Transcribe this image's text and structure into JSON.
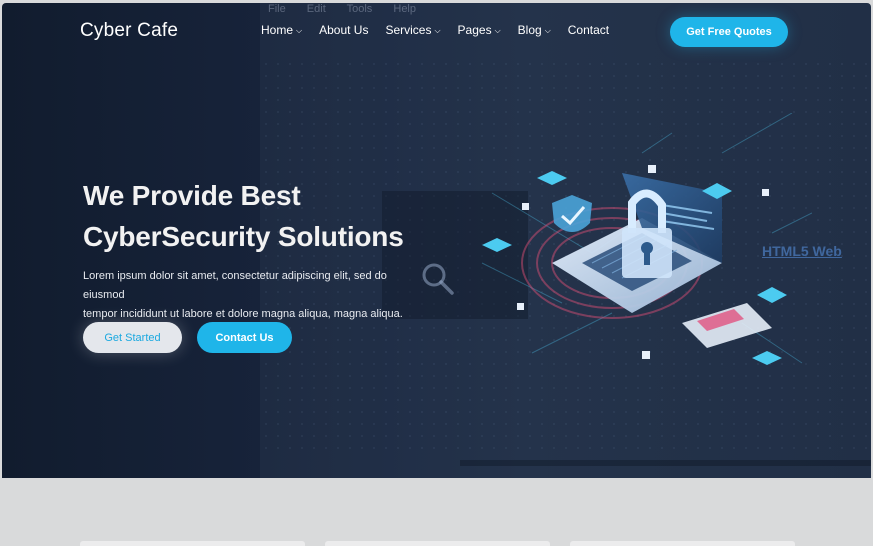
{
  "brand": {
    "logo": "Cyber Cafe"
  },
  "nav": {
    "items": [
      {
        "label": "Home",
        "dropdown": true
      },
      {
        "label": "About Us",
        "dropdown": false
      },
      {
        "label": "Services",
        "dropdown": true
      },
      {
        "label": "Pages",
        "dropdown": true
      },
      {
        "label": "Blog",
        "dropdown": true
      },
      {
        "label": "Contact",
        "dropdown": false
      }
    ],
    "cta_label": "Get Free Quotes"
  },
  "hero": {
    "headline_line1": "We Provide Best",
    "headline_line2": "CyberSecurity Solutions",
    "description_line1": "Lorem ipsum dolor sit amet, consectetur adipiscing elit, sed do eiusmod",
    "description_line2": "tempor incididunt ut labore et dolore magna aliqua, magna aliqua.",
    "primary_button": "Get Started",
    "secondary_button": "Contact Us"
  },
  "background_overlay": {
    "menu": [
      "File",
      "Edit",
      "Tools",
      "Help"
    ],
    "link_text": "HTML5 Web"
  },
  "colors": {
    "accent": "#1fb5e9",
    "hero_bg": "#17233a",
    "page_bg": "#d9dadb"
  },
  "icons": [
    "chevron-down-icon",
    "search-icon",
    "padlock-laptop-illustration"
  ]
}
